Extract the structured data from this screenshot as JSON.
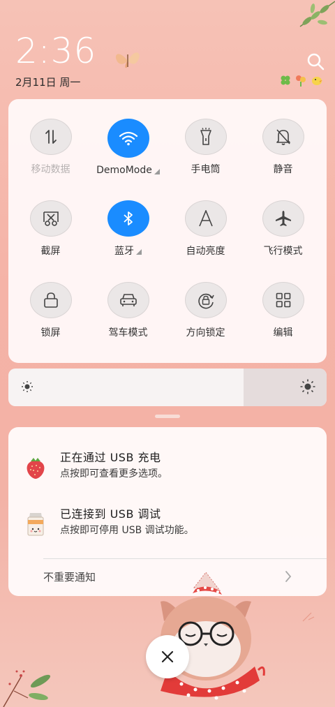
{
  "status": {
    "time": "2:36",
    "date": "2月11日 周一",
    "icons": [
      "clover-icon",
      "flowers-icon",
      "chick-icon"
    ]
  },
  "quick_settings": [
    {
      "name": "mobile-data",
      "label": "移动数据",
      "icon": "arrows-updown-icon",
      "active": false,
      "dim": true,
      "has_menu": false
    },
    {
      "name": "wifi",
      "label": "DemoMode",
      "icon": "wifi-icon",
      "active": true,
      "dim": false,
      "has_menu": true
    },
    {
      "name": "flashlight",
      "label": "手电筒",
      "icon": "flashlight-icon",
      "active": false,
      "dim": false,
      "has_menu": false
    },
    {
      "name": "mute",
      "label": "静音",
      "icon": "bell-off-icon",
      "active": false,
      "dim": false,
      "has_menu": false
    },
    {
      "name": "screenshot",
      "label": "截屏",
      "icon": "scissors-icon",
      "active": false,
      "dim": false,
      "has_menu": false
    },
    {
      "name": "bluetooth",
      "label": "蓝牙",
      "icon": "bluetooth-icon",
      "active": true,
      "dim": false,
      "has_menu": true
    },
    {
      "name": "auto-brightness",
      "label": "自动亮度",
      "icon": "letter-a-icon",
      "active": false,
      "dim": false,
      "has_menu": false
    },
    {
      "name": "airplane",
      "label": "飞行模式",
      "icon": "airplane-icon",
      "active": false,
      "dim": false,
      "has_menu": false
    },
    {
      "name": "lock-screen",
      "label": "锁屏",
      "icon": "lock-icon",
      "active": false,
      "dim": false,
      "has_menu": false
    },
    {
      "name": "driving-mode",
      "label": "驾车模式",
      "icon": "car-icon",
      "active": false,
      "dim": false,
      "has_menu": false
    },
    {
      "name": "rotation-lock",
      "label": "方向锁定",
      "icon": "rotation-lock-icon",
      "active": false,
      "dim": false,
      "has_menu": false
    },
    {
      "name": "edit",
      "label": "编辑",
      "icon": "grid-icon",
      "active": false,
      "dim": false,
      "has_menu": false
    }
  ],
  "brightness": {
    "level": 0.74
  },
  "notifications": [
    {
      "title": "正在通过 USB 充电",
      "subtitle": "点按即可查看更多选项。",
      "icon": "strawberry-icon"
    },
    {
      "title": "已连接到 USB 调试",
      "subtitle": "点按即可停用 USB 调试功能。",
      "icon": "milk-carton-icon"
    }
  ],
  "minor_notifications": {
    "label": "不重要通知"
  },
  "colors": {
    "accent": "#1a8cff",
    "background": "#f5b3a7"
  }
}
